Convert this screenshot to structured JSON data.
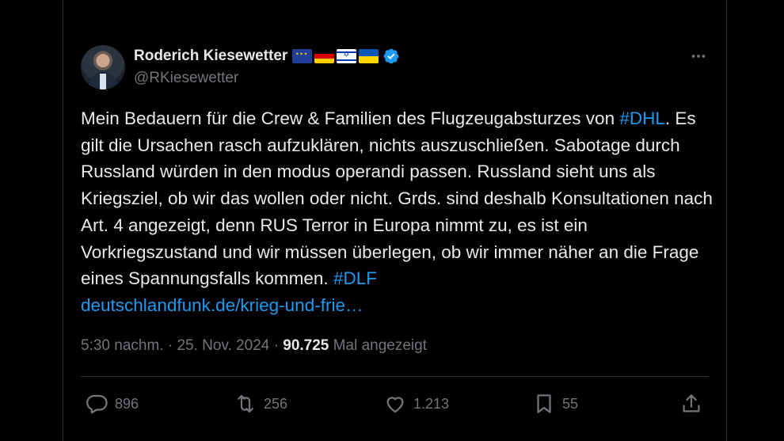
{
  "author": {
    "display_name": "Roderich Kiesewetter",
    "handle": "@RKiesewetter",
    "flags": [
      "eu-flag",
      "germany-flag",
      "israel-flag",
      "ukraine-flag"
    ],
    "verified": true,
    "verified_color": "#1d9bf0"
  },
  "tweet": {
    "text_before_tag1": "Mein Bedauern für die Crew & Familien des Flugzeugabsturzes von ",
    "hashtag1": "#DHL",
    "text_after_tag1": ". Es gilt die Ursachen rasch aufzuklären, nichts auszuschließen. Sabotage durch Russland würden in den modus operandi passen. Russland sieht uns als Kriegsziel, ob wir das wollen oder nicht. Grds. sind deshalb Konsultationen nach Art. 4 angezeigt, denn RUS Terror in Europa nimmt zu, es ist ein Vorkriegszustand und wir müssen überlegen, ob wir immer näher an die Frage eines Spannungsfalls kommen. ",
    "hashtag2": "#DLF",
    "link": "deutschlandfunk.de/krieg-und-frie…",
    "link_color": "#1d9bf0"
  },
  "meta": {
    "time": "5:30 nachm.",
    "separator": "·",
    "date": "25. Nov. 2024",
    "views_count": "90.725",
    "views_label": "Mal angezeigt"
  },
  "actions": {
    "replies": "896",
    "reposts": "256",
    "likes": "1.213",
    "bookmarks": "55"
  },
  "colors": {
    "background": "#000000",
    "text": "#e7e9ea",
    "secondary": "#71767b",
    "border": "#2f3336"
  }
}
